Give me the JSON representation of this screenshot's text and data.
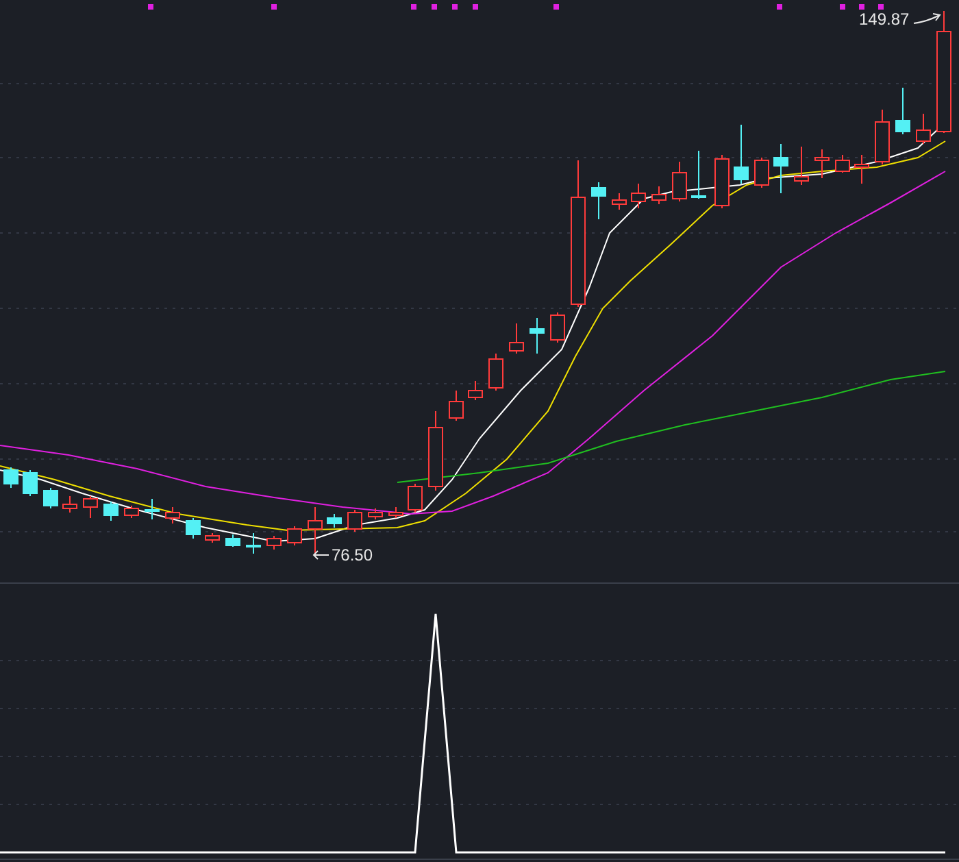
{
  "price_chart": {
    "markers": [
      {
        "kind": "high",
        "text": "149.87"
      },
      {
        "kind": "low",
        "text": "76.50"
      }
    ]
  }
}
